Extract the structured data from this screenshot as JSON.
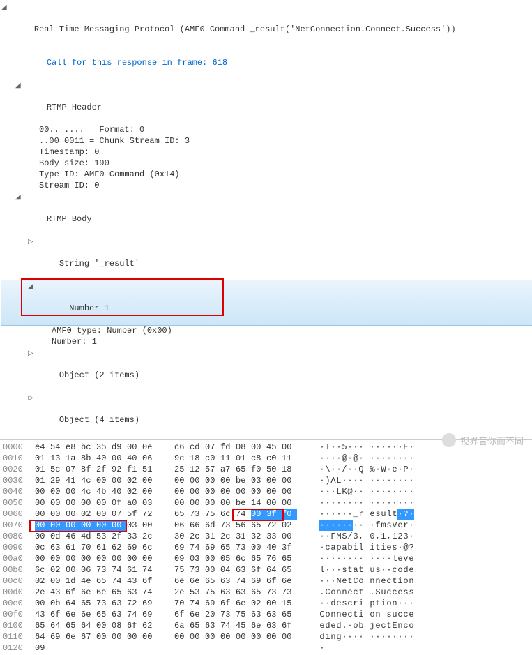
{
  "tree": {
    "root": "Real Time Messaging Protocol (AMF0 Command _result('NetConnection.Connect.Success'))",
    "call_link": "Call for this response in frame: 618",
    "header": {
      "label": "RTMP Header",
      "format": "00.. .... = Format: 0",
      "csid": "..00 0011 = Chunk Stream ID: 3",
      "timestamp": "Timestamp: 0",
      "bodysize": "Body size: 190",
      "typeid": "Type ID: AMF0 Command (0x14)",
      "streamid": "Stream ID: 0"
    },
    "body": {
      "label": "RTMP Body",
      "string": "String '_result'",
      "number1": {
        "label": "Number 1",
        "amf0type": "AMF0 type: Number (0x00)",
        "number": "Number: 1"
      },
      "obj2": "Object (2 items)",
      "obj4": "Object (4 items)"
    }
  },
  "icons": {
    "right": "▷",
    "down": "◢"
  },
  "hex": {
    "lines": [
      {
        "off": "0000",
        "b": [
          "e4",
          "54",
          "e8",
          "bc",
          "35",
          "d9",
          "00",
          "0e",
          "c6",
          "cd",
          "07",
          "fd",
          "08",
          "00",
          "45",
          "00"
        ],
        "a": [
          "·",
          "T",
          "·",
          "·",
          "5",
          "·",
          "·",
          "·",
          "·",
          "·",
          "·",
          "·",
          "·",
          "·",
          "E",
          "·"
        ]
      },
      {
        "off": "0010",
        "b": [
          "01",
          "13",
          "1a",
          "8b",
          "40",
          "00",
          "40",
          "06",
          "9c",
          "18",
          "c0",
          "11",
          "01",
          "c8",
          "c0",
          "11"
        ],
        "a": [
          "·",
          "·",
          "·",
          "·",
          "@",
          "·",
          "@",
          "·",
          "·",
          "·",
          "·",
          "·",
          "·",
          "·",
          "·",
          "·"
        ]
      },
      {
        "off": "0020",
        "b": [
          "01",
          "5c",
          "07",
          "8f",
          "2f",
          "92",
          "f1",
          "51",
          "25",
          "12",
          "57",
          "a7",
          "65",
          "f0",
          "50",
          "18"
        ],
        "a": [
          "·",
          "\\",
          "·",
          "·",
          "/",
          "·",
          "·",
          "Q",
          "%",
          "·",
          "W",
          "·",
          "e",
          "·",
          "P",
          "·"
        ]
      },
      {
        "off": "0030",
        "b": [
          "01",
          "29",
          "41",
          "4c",
          "00",
          "00",
          "02",
          "00",
          "00",
          "00",
          "00",
          "00",
          "be",
          "03",
          "00",
          "00"
        ],
        "a": [
          "·",
          ")",
          "A",
          "L",
          "·",
          "·",
          "·",
          "·",
          "·",
          "·",
          "·",
          "·",
          "·",
          "·",
          "·",
          "·"
        ]
      },
      {
        "off": "0040",
        "b": [
          "00",
          "00",
          "00",
          "4c",
          "4b",
          "40",
          "02",
          "00",
          "00",
          "00",
          "00",
          "00",
          "00",
          "00",
          "00",
          "00"
        ],
        "a": [
          "·",
          "·",
          "·",
          "L",
          "K",
          "@",
          "·",
          "·",
          "·",
          "·",
          "·",
          "·",
          "·",
          "·",
          "·",
          "·"
        ]
      },
      {
        "off": "0050",
        "b": [
          "00",
          "00",
          "00",
          "00",
          "00",
          "0f",
          "a0",
          "03",
          "00",
          "00",
          "00",
          "00",
          "be",
          "14",
          "00",
          "00"
        ],
        "a": [
          "·",
          "·",
          "·",
          "·",
          "·",
          "·",
          "·",
          "·",
          "·",
          "·",
          "·",
          "·",
          "·",
          "·",
          "·",
          "·"
        ]
      },
      {
        "off": "0060",
        "b": [
          "00",
          "00",
          "00",
          "02",
          "00",
          "07",
          "5f",
          "72",
          "65",
          "73",
          "75",
          "6c",
          "74",
          "00",
          "3f",
          "f0"
        ],
        "a": [
          "·",
          "·",
          "·",
          "·",
          "·",
          "·",
          "_",
          "r",
          "e",
          "s",
          "u",
          "l",
          "t",
          "·",
          "?",
          "·"
        ],
        "hl": [
          13,
          14,
          15
        ],
        "hla": [
          13,
          14,
          15
        ]
      },
      {
        "off": "0070",
        "b": [
          "00",
          "00",
          "00",
          "00",
          "00",
          "00",
          "03",
          "00",
          "06",
          "66",
          "6d",
          "73",
          "56",
          "65",
          "72",
          "02"
        ],
        "a": [
          "·",
          "·",
          "·",
          "·",
          "·",
          "·",
          "·",
          "·",
          "·",
          "f",
          "m",
          "s",
          "V",
          "e",
          "r",
          "·"
        ],
        "hl": [
          0,
          1,
          2,
          3,
          4,
          5
        ],
        "hla": [
          0,
          1,
          2,
          3,
          4,
          5
        ]
      },
      {
        "off": "0080",
        "b": [
          "00",
          "0d",
          "46",
          "4d",
          "53",
          "2f",
          "33",
          "2c",
          "30",
          "2c",
          "31",
          "2c",
          "31",
          "32",
          "33",
          "00"
        ],
        "a": [
          "·",
          "·",
          "F",
          "M",
          "S",
          "/",
          "3",
          ",",
          "0",
          ",",
          "1",
          ",",
          "1",
          "2",
          "3",
          "·"
        ]
      },
      {
        "off": "0090",
        "b": [
          "0c",
          "63",
          "61",
          "70",
          "61",
          "62",
          "69",
          "6c",
          "69",
          "74",
          "69",
          "65",
          "73",
          "00",
          "40",
          "3f"
        ],
        "a": [
          "·",
          "c",
          "a",
          "p",
          "a",
          "b",
          "i",
          "l",
          "i",
          "t",
          "i",
          "e",
          "s",
          "·",
          "@",
          "?"
        ]
      },
      {
        "off": "00a0",
        "b": [
          "00",
          "00",
          "00",
          "00",
          "00",
          "00",
          "00",
          "00",
          "09",
          "03",
          "00",
          "05",
          "6c",
          "65",
          "76",
          "65"
        ],
        "a": [
          "·",
          "·",
          "·",
          "·",
          "·",
          "·",
          "·",
          "·",
          "·",
          "·",
          "·",
          "·",
          "l",
          "e",
          "v",
          "e"
        ]
      },
      {
        "off": "00b0",
        "b": [
          "6c",
          "02",
          "00",
          "06",
          "73",
          "74",
          "61",
          "74",
          "75",
          "73",
          "00",
          "04",
          "63",
          "6f",
          "64",
          "65"
        ],
        "a": [
          "l",
          "·",
          "·",
          "·",
          "s",
          "t",
          "a",
          "t",
          "u",
          "s",
          "·",
          "·",
          "c",
          "o",
          "d",
          "e"
        ]
      },
      {
        "off": "00c0",
        "b": [
          "02",
          "00",
          "1d",
          "4e",
          "65",
          "74",
          "43",
          "6f",
          "6e",
          "6e",
          "65",
          "63",
          "74",
          "69",
          "6f",
          "6e"
        ],
        "a": [
          "·",
          "·",
          "·",
          "N",
          "e",
          "t",
          "C",
          "o",
          "n",
          "n",
          "e",
          "c",
          "t",
          "i",
          "o",
          "n"
        ]
      },
      {
        "off": "00d0",
        "b": [
          "2e",
          "43",
          "6f",
          "6e",
          "6e",
          "65",
          "63",
          "74",
          "2e",
          "53",
          "75",
          "63",
          "63",
          "65",
          "73",
          "73"
        ],
        "a": [
          ".",
          "C",
          "o",
          "n",
          "n",
          "e",
          "c",
          "t",
          ".",
          "S",
          "u",
          "c",
          "c",
          "e",
          "s",
          "s"
        ]
      },
      {
        "off": "00e0",
        "b": [
          "00",
          "0b",
          "64",
          "65",
          "73",
          "63",
          "72",
          "69",
          "70",
          "74",
          "69",
          "6f",
          "6e",
          "02",
          "00",
          "15"
        ],
        "a": [
          "·",
          "·",
          "d",
          "e",
          "s",
          "c",
          "r",
          "i",
          "p",
          "t",
          "i",
          "o",
          "n",
          "·",
          "·",
          "·"
        ]
      },
      {
        "off": "00f0",
        "b": [
          "43",
          "6f",
          "6e",
          "6e",
          "65",
          "63",
          "74",
          "69",
          "6f",
          "6e",
          "20",
          "73",
          "75",
          "63",
          "63",
          "65"
        ],
        "a": [
          "C",
          "o",
          "n",
          "n",
          "e",
          "c",
          "t",
          "i",
          "o",
          "n",
          " ",
          "s",
          "u",
          "c",
          "c",
          "e"
        ]
      },
      {
        "off": "0100",
        "b": [
          "65",
          "64",
          "65",
          "64",
          "00",
          "08",
          "6f",
          "62",
          "6a",
          "65",
          "63",
          "74",
          "45",
          "6e",
          "63",
          "6f"
        ],
        "a": [
          "e",
          "d",
          "e",
          "d",
          ".",
          "·",
          "o",
          "b",
          "j",
          "e",
          "c",
          "t",
          "E",
          "n",
          "c",
          "o"
        ]
      },
      {
        "off": "0110",
        "b": [
          "64",
          "69",
          "6e",
          "67",
          "00",
          "00",
          "00",
          "00",
          "00",
          "00",
          "00",
          "00",
          "00",
          "00",
          "00",
          "00"
        ],
        "a": [
          "d",
          "i",
          "n",
          "g",
          "·",
          "·",
          "·",
          "·",
          "·",
          "·",
          "·",
          "·",
          "·",
          "·",
          "·",
          "·"
        ]
      },
      {
        "off": "0120",
        "b": [
          "09",
          "",
          "",
          "",
          "",
          "",
          "",
          "",
          "",
          "",
          "",
          "",
          "",
          "",
          "",
          ""
        ],
        "a": [
          "·",
          "",
          "",
          "",
          "",
          "",
          "",
          "",
          "",
          "",
          "",
          "",
          "",
          "",
          "",
          ""
        ]
      }
    ]
  },
  "watermark": "视界音你而不同"
}
